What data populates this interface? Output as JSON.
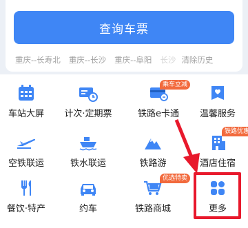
{
  "search": {
    "button_label": "查询车票",
    "history": [
      "重庆--长寿北",
      "重庆--长沙",
      "重庆--阜阳"
    ],
    "history_partial": "长沙",
    "clear_label": "清除历史"
  },
  "grid": {
    "items": [
      {
        "label": "车站大屏",
        "icon": "station-screen-icon"
      },
      {
        "label": "计次·定期票",
        "icon": "ticket-card-icon"
      },
      {
        "label": "铁路e卡通",
        "icon": "e-card-icon",
        "badge": "乘车立减"
      },
      {
        "label": "温馨服务",
        "icon": "heart-service-icon"
      },
      {
        "label": "空铁联运",
        "icon": "plane-train-icon"
      },
      {
        "label": "铁水联运",
        "icon": "ship-icon"
      },
      {
        "label": "铁路游",
        "icon": "mountain-icon"
      },
      {
        "label": "酒店住宿",
        "icon": "hotel-icon",
        "badge": "铁路优惠"
      },
      {
        "label": "餐饮·特产",
        "icon": "food-icon"
      },
      {
        "label": "约车",
        "icon": "car-icon"
      },
      {
        "label": "铁路商城",
        "icon": "cart-icon",
        "badge": "优选特卖"
      },
      {
        "label": "更多",
        "icon": "more-grid-icon"
      }
    ]
  },
  "colors": {
    "primary": "#3f86f5",
    "badge": "#f26a3d",
    "highlight": "#e8192c"
  }
}
